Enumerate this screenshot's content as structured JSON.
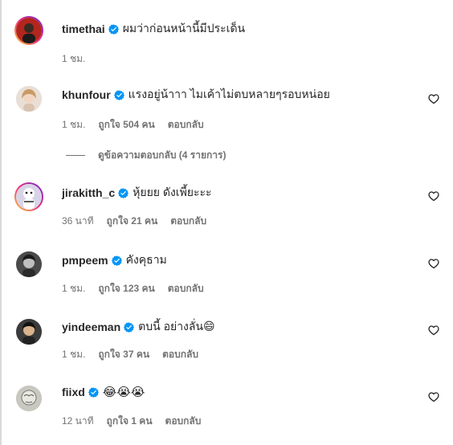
{
  "comments": [
    {
      "username": "timethai",
      "text": "ผมว่าก่อนหน้านี้มีประเด็น",
      "time": "1 ชม.",
      "likes": "",
      "reply": "",
      "has_story": true
    },
    {
      "username": "khunfour",
      "text": "แรงอยู่น้าาา ไมเค้าไม่ตบหลายๆรอบหน่อย",
      "time": "1 ชม.",
      "likes": "ถูกใจ 504 คน",
      "reply": "ตอบกลับ",
      "has_story": false
    },
    {
      "username": "jirakitth_c",
      "text": "หุ้ยยย ดังเพี้ยะะะ",
      "time": "36 นาที",
      "likes": "ถูกใจ 21 คน",
      "reply": "ตอบกลับ",
      "has_story": true
    },
    {
      "username": "pmpeem",
      "text": "คังคุธาม",
      "time": "1 ชม.",
      "likes": "ถูกใจ 123 คน",
      "reply": "ตอบกลับ",
      "has_story": false
    },
    {
      "username": "yindeeman",
      "text": "ตบนี้ อย่างลั่น😄",
      "time": "1 ชม.",
      "likes": "ถูกใจ 37 คน",
      "reply": "ตอบกลับ",
      "has_story": false
    },
    {
      "username": "fiixd",
      "text": "😂😭😭",
      "time": "12 นาที",
      "likes": "ถูกใจ 1 คน",
      "reply": "ตอบกลับ",
      "has_story": false
    }
  ],
  "view_replies_label": "ดูข้อความตอบกลับ (4 รายการ)",
  "colors": {
    "verified": "#0095f6",
    "secondary_text": "#737373",
    "primary_text": "#262626"
  },
  "icons": {
    "verified": "verified-badge-icon",
    "like": "heart-outline-icon"
  }
}
